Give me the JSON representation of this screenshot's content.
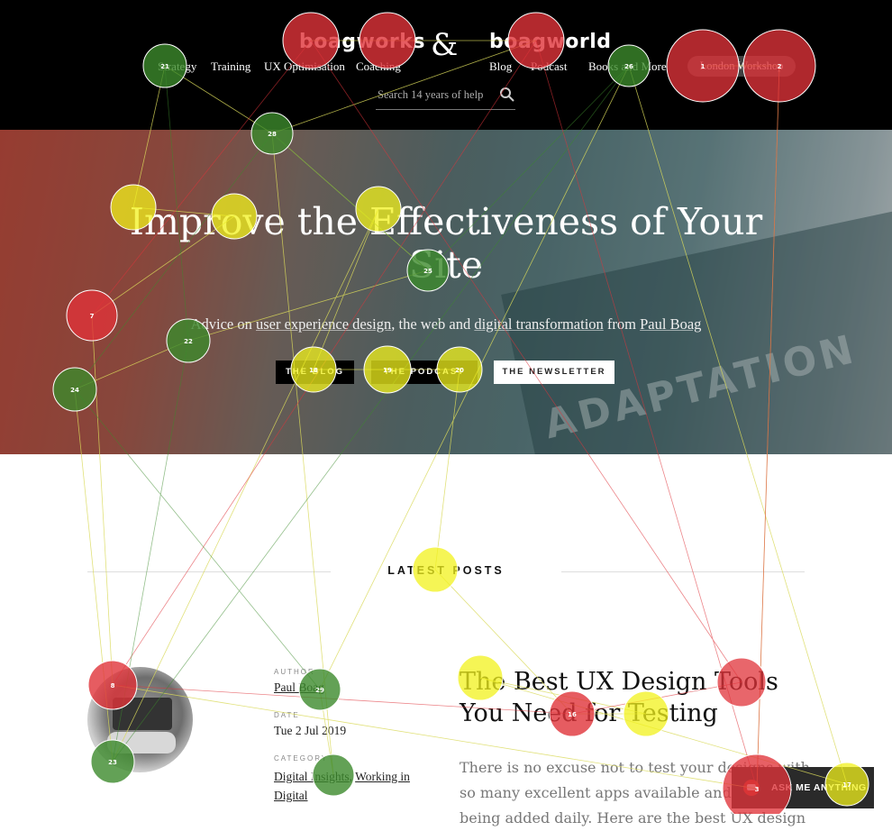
{
  "header": {
    "logo_left": "boagworks",
    "ampersand": "&",
    "logo_right": "boagworld",
    "nav_left": [
      "Strategy",
      "Training",
      "UX Optimisation",
      "Coaching"
    ],
    "nav_right": [
      "Blog",
      "Podcast",
      "Books and More"
    ],
    "workshop_button": "London Workshop",
    "search_placeholder": "Search 14 years of help"
  },
  "hero": {
    "title": "Improve the Effectiveness of Your Site",
    "sub_pre": "Advice on ",
    "sub_link1": "user experience design",
    "sub_mid1": ", the web and ",
    "sub_link2": "digital transformation",
    "sub_mid2": " from ",
    "sub_link3": "Paul Boag",
    "book_text": "ADAPTATION",
    "buttons": [
      "THE BLOG",
      "THE PODCAST",
      "THE NEWSLETTER"
    ]
  },
  "latest": {
    "heading": "LATEST POSTS",
    "author_label": "AUTHOR",
    "author": "Paul Boag",
    "date_label": "DATE",
    "date": "Tue 2 Jul 2019",
    "category_label": "CATEGORY",
    "category_1": "Digital Insights",
    "category_sep": ", ",
    "category_2a": "Working in",
    "category_2b": "Digital",
    "title_line1": "The Best UX Design Tools",
    "title_line2": "You Need for Testing",
    "excerpt_line1": "There is no excuse not to test your designs with",
    "excerpt_line2": "so many excellent apps available and more",
    "excerpt_line3": "being added daily. Here are the best UX design"
  },
  "ask_button": "ASK ME ANYTHING",
  "overlay": {
    "colors": {
      "red": "#e0333a",
      "yellow": "#f2f21c",
      "green": "#3c8a2c"
    },
    "fixations": [
      {
        "label": "1",
        "color": "red"
      },
      {
        "label": "2",
        "color": "red"
      },
      {
        "label": "3",
        "color": "red"
      },
      {
        "label": "7",
        "color": "red"
      },
      {
        "label": "8",
        "color": "red"
      },
      {
        "label": "16",
        "color": "red"
      },
      {
        "label": "17",
        "color": "yellow"
      },
      {
        "label": "18",
        "color": "yellow"
      },
      {
        "label": "19",
        "color": "yellow"
      },
      {
        "label": "20",
        "color": "yellow"
      },
      {
        "label": "21",
        "color": "green"
      },
      {
        "label": "22",
        "color": "green"
      },
      {
        "label": "23",
        "color": "green"
      },
      {
        "label": "24",
        "color": "green"
      },
      {
        "label": "25",
        "color": "green"
      },
      {
        "label": "26",
        "color": "green"
      },
      {
        "label": "28",
        "color": "green"
      },
      {
        "label": "29",
        "color": "green"
      }
    ]
  }
}
